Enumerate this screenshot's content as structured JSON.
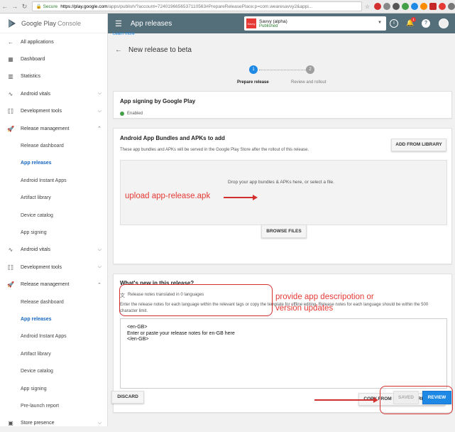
{
  "browser": {
    "secure_label": "Secure",
    "url_host": "https://play.google.com",
    "url_path": "/apps/publish/?account=7240196656537110563#PrepareReleasePlace:p=com.wearesavvy2&appi..."
  },
  "brand": {
    "name": "Google Play",
    "suffix": "Console"
  },
  "sidebar": {
    "items": [
      {
        "label": "All applications",
        "icon": "arrow-left-icon"
      },
      {
        "label": "Dashboard",
        "icon": "dashboard-icon"
      },
      {
        "label": "Statistics",
        "icon": "statistics-icon"
      },
      {
        "label": "Android vitals",
        "icon": "vitals-icon"
      },
      {
        "label": "Development tools",
        "icon": "devtools-icon"
      },
      {
        "label": "Release management",
        "icon": "rocket-icon"
      },
      {
        "label": "Release dashboard"
      },
      {
        "label": "App releases"
      },
      {
        "label": "Android Instant Apps"
      },
      {
        "label": "Artifact library"
      },
      {
        "label": "Device catalog"
      },
      {
        "label": "App signing"
      },
      {
        "label": "Android vitals",
        "icon": "vitals-icon"
      },
      {
        "label": "Development tools",
        "icon": "devtools-icon"
      },
      {
        "label": "Release management",
        "icon": "rocket-icon"
      },
      {
        "label": "Release dashboard"
      },
      {
        "label": "App releases"
      },
      {
        "label": "Android Instant Apps"
      },
      {
        "label": "Artifact library"
      },
      {
        "label": "Device catalog"
      },
      {
        "label": "App signing"
      },
      {
        "label": "Pre-launch report"
      },
      {
        "label": "Store presence",
        "icon": "store-icon"
      }
    ]
  },
  "topbar": {
    "title": "App releases",
    "app_name": "Savvy (alpha)",
    "app_status": "Published",
    "app_icon_text": "Savvy",
    "notif_count": "1"
  },
  "page": {
    "learn_more": "Learn more",
    "title": "New release to beta",
    "steps": [
      {
        "num": "1",
        "label": "Prepare release"
      },
      {
        "num": "2",
        "label": "Review and rollout"
      }
    ]
  },
  "signing": {
    "title": "App signing by Google Play",
    "status": "Enabled"
  },
  "bundles": {
    "title": "Android App Bundles and APKs to add",
    "desc": "These app bundles and APKs will be served in the Google Play Store after the rollout of this release.",
    "add_btn": "ADD FROM LIBRARY",
    "drop_text": "Drop your app bundles & APKs here, or select a file.",
    "browse_btn": "BROWSE FILES"
  },
  "whatsnew": {
    "title": "What's new in this release?",
    "translated": "Release notes translated in 0 languages",
    "instructions": "Enter the release notes for each language within the relevant tags or copy the template for offline editing. Release notes for each language should be within the 500 character limit.",
    "lines": [
      "<en-GB>",
      "Enter or paste your release notes for en-GB here",
      "</en-GB>"
    ],
    "copy_btn": "COPY FROM PREVIOUS RELEASE"
  },
  "footer": {
    "discard": "DISCARD",
    "saved": "SAVED",
    "review": "REVIEW"
  },
  "annotations": {
    "upload": "upload app-release.apk",
    "describe_1": "provide app descripotion or",
    "describe_2": "version updates"
  }
}
